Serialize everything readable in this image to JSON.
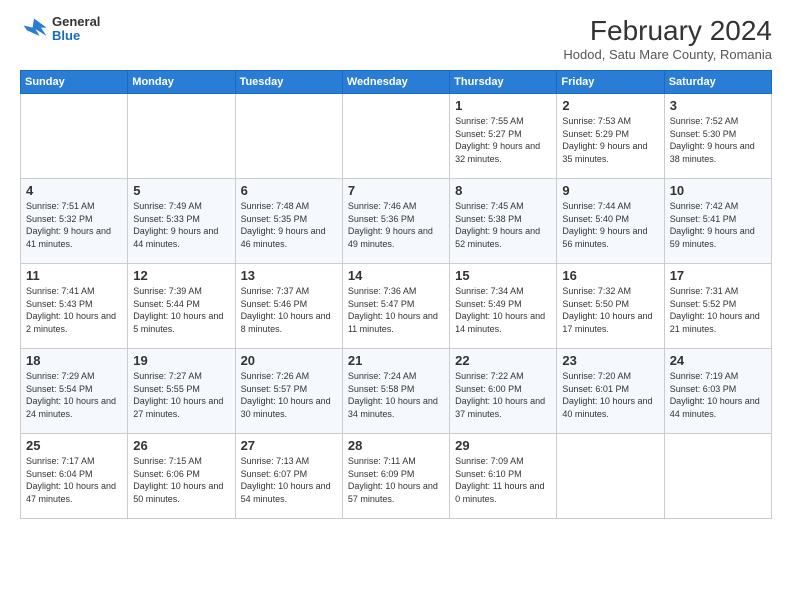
{
  "header": {
    "logo": {
      "general": "General",
      "blue": "Blue"
    },
    "title": "February 2024",
    "location": "Hodod, Satu Mare County, Romania"
  },
  "weekdays": [
    "Sunday",
    "Monday",
    "Tuesday",
    "Wednesday",
    "Thursday",
    "Friday",
    "Saturday"
  ],
  "weeks": [
    [
      {
        "day": "",
        "info": ""
      },
      {
        "day": "",
        "info": ""
      },
      {
        "day": "",
        "info": ""
      },
      {
        "day": "",
        "info": ""
      },
      {
        "day": "1",
        "info": "Sunrise: 7:55 AM\nSunset: 5:27 PM\nDaylight: 9 hours\nand 32 minutes."
      },
      {
        "day": "2",
        "info": "Sunrise: 7:53 AM\nSunset: 5:29 PM\nDaylight: 9 hours\nand 35 minutes."
      },
      {
        "day": "3",
        "info": "Sunrise: 7:52 AM\nSunset: 5:30 PM\nDaylight: 9 hours\nand 38 minutes."
      }
    ],
    [
      {
        "day": "4",
        "info": "Sunrise: 7:51 AM\nSunset: 5:32 PM\nDaylight: 9 hours\nand 41 minutes."
      },
      {
        "day": "5",
        "info": "Sunrise: 7:49 AM\nSunset: 5:33 PM\nDaylight: 9 hours\nand 44 minutes."
      },
      {
        "day": "6",
        "info": "Sunrise: 7:48 AM\nSunset: 5:35 PM\nDaylight: 9 hours\nand 46 minutes."
      },
      {
        "day": "7",
        "info": "Sunrise: 7:46 AM\nSunset: 5:36 PM\nDaylight: 9 hours\nand 49 minutes."
      },
      {
        "day": "8",
        "info": "Sunrise: 7:45 AM\nSunset: 5:38 PM\nDaylight: 9 hours\nand 52 minutes."
      },
      {
        "day": "9",
        "info": "Sunrise: 7:44 AM\nSunset: 5:40 PM\nDaylight: 9 hours\nand 56 minutes."
      },
      {
        "day": "10",
        "info": "Sunrise: 7:42 AM\nSunset: 5:41 PM\nDaylight: 9 hours\nand 59 minutes."
      }
    ],
    [
      {
        "day": "11",
        "info": "Sunrise: 7:41 AM\nSunset: 5:43 PM\nDaylight: 10 hours\nand 2 minutes."
      },
      {
        "day": "12",
        "info": "Sunrise: 7:39 AM\nSunset: 5:44 PM\nDaylight: 10 hours\nand 5 minutes."
      },
      {
        "day": "13",
        "info": "Sunrise: 7:37 AM\nSunset: 5:46 PM\nDaylight: 10 hours\nand 8 minutes."
      },
      {
        "day": "14",
        "info": "Sunrise: 7:36 AM\nSunset: 5:47 PM\nDaylight: 10 hours\nand 11 minutes."
      },
      {
        "day": "15",
        "info": "Sunrise: 7:34 AM\nSunset: 5:49 PM\nDaylight: 10 hours\nand 14 minutes."
      },
      {
        "day": "16",
        "info": "Sunrise: 7:32 AM\nSunset: 5:50 PM\nDaylight: 10 hours\nand 17 minutes."
      },
      {
        "day": "17",
        "info": "Sunrise: 7:31 AM\nSunset: 5:52 PM\nDaylight: 10 hours\nand 21 minutes."
      }
    ],
    [
      {
        "day": "18",
        "info": "Sunrise: 7:29 AM\nSunset: 5:54 PM\nDaylight: 10 hours\nand 24 minutes."
      },
      {
        "day": "19",
        "info": "Sunrise: 7:27 AM\nSunset: 5:55 PM\nDaylight: 10 hours\nand 27 minutes."
      },
      {
        "day": "20",
        "info": "Sunrise: 7:26 AM\nSunset: 5:57 PM\nDaylight: 10 hours\nand 30 minutes."
      },
      {
        "day": "21",
        "info": "Sunrise: 7:24 AM\nSunset: 5:58 PM\nDaylight: 10 hours\nand 34 minutes."
      },
      {
        "day": "22",
        "info": "Sunrise: 7:22 AM\nSunset: 6:00 PM\nDaylight: 10 hours\nand 37 minutes."
      },
      {
        "day": "23",
        "info": "Sunrise: 7:20 AM\nSunset: 6:01 PM\nDaylight: 10 hours\nand 40 minutes."
      },
      {
        "day": "24",
        "info": "Sunrise: 7:19 AM\nSunset: 6:03 PM\nDaylight: 10 hours\nand 44 minutes."
      }
    ],
    [
      {
        "day": "25",
        "info": "Sunrise: 7:17 AM\nSunset: 6:04 PM\nDaylight: 10 hours\nand 47 minutes."
      },
      {
        "day": "26",
        "info": "Sunrise: 7:15 AM\nSunset: 6:06 PM\nDaylight: 10 hours\nand 50 minutes."
      },
      {
        "day": "27",
        "info": "Sunrise: 7:13 AM\nSunset: 6:07 PM\nDaylight: 10 hours\nand 54 minutes."
      },
      {
        "day": "28",
        "info": "Sunrise: 7:11 AM\nSunset: 6:09 PM\nDaylight: 10 hours\nand 57 minutes."
      },
      {
        "day": "29",
        "info": "Sunrise: 7:09 AM\nSunset: 6:10 PM\nDaylight: 11 hours\nand 0 minutes."
      },
      {
        "day": "",
        "info": ""
      },
      {
        "day": "",
        "info": ""
      }
    ]
  ]
}
